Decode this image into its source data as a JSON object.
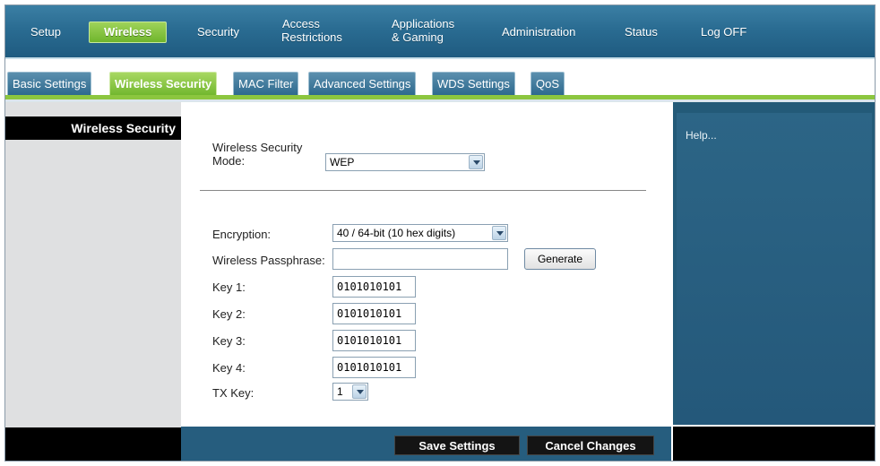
{
  "nav": {
    "setup": "Setup",
    "wireless": "Wireless",
    "security": "Security",
    "access_line1": "Access",
    "access_line2": "Restrictions",
    "apps_line1": "Applications",
    "apps_line2": "& Gaming",
    "administration": "Administration",
    "status": "Status",
    "logoff": "Log OFF"
  },
  "tabs": {
    "basic": "Basic Settings",
    "security": "Wireless Security",
    "mac": "MAC Filter",
    "advanced": "Advanced Settings",
    "wds": "WDS Settings",
    "qos": "QoS"
  },
  "sidebar": {
    "title": "Wireless Security"
  },
  "form": {
    "mode_label_line1": "Wireless Security",
    "mode_label_line2": "Mode:",
    "mode_value": "WEP",
    "encryption_label": "Encryption:",
    "encryption_value": "40 / 64-bit (10 hex digits)",
    "passphrase_label": "Wireless Passphrase:",
    "passphrase_value": "",
    "generate_label": "Generate",
    "key1_label": "Key 1:",
    "key1_value": "0101010101",
    "key2_label": "Key 2:",
    "key2_value": "0101010101",
    "key3_label": "Key 3:",
    "key3_value": "0101010101",
    "key4_label": "Key 4:",
    "key4_value": "0101010101",
    "txkey_label": "TX Key:",
    "txkey_value": "1"
  },
  "help": {
    "text": "Help..."
  },
  "footer": {
    "save": "Save Settings",
    "cancel": "Cancel Changes"
  }
}
